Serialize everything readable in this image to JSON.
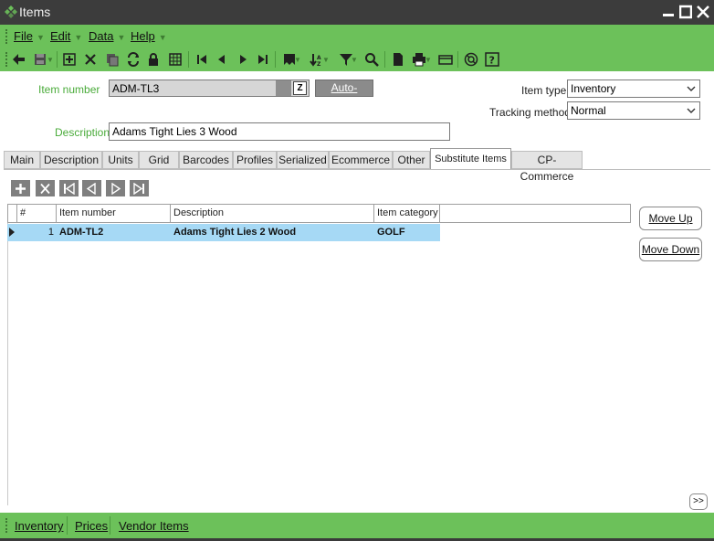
{
  "window": {
    "title": "Items",
    "app_icon": "pinwheel-icon",
    "controls": [
      "minimize-icon",
      "maximize-icon",
      "close-icon"
    ]
  },
  "menu": {
    "items": [
      {
        "label": "File"
      },
      {
        "label": "Edit"
      },
      {
        "label": "Data"
      },
      {
        "label": "Help"
      }
    ]
  },
  "toolbar": {
    "icons": [
      "back-arrow-icon",
      "save-icon",
      "add-icon",
      "delete-icon",
      "copy-icon",
      "refresh-icon",
      "lock-icon",
      "grid-icon",
      "first-record-icon",
      "previous-record-icon",
      "next-record-icon",
      "last-record-icon",
      "bookmark-icon",
      "sort-icon",
      "filter-icon",
      "search-icon",
      "document-icon",
      "print-icon",
      "calculator-icon",
      "support-icon",
      "help-icon"
    ]
  },
  "form": {
    "item_number_label": "Item number",
    "item_number_value": "ADM-TL3",
    "auto_assign_label": "Auto-assign",
    "description_label": "Description",
    "description_value": "Adams Tight Lies 3 Wood",
    "item_type_label": "Item type",
    "item_type_value": "Inventory",
    "tracking_method_label": "Tracking method",
    "tracking_method_value": "Normal"
  },
  "tabs": [
    {
      "label": "Main"
    },
    {
      "label": "Description"
    },
    {
      "label": "Units"
    },
    {
      "label": "Grid"
    },
    {
      "label": "Barcodes"
    },
    {
      "label": "Profiles"
    },
    {
      "label": "Serialized"
    },
    {
      "label": "Ecommerce"
    },
    {
      "label": "Other"
    },
    {
      "label": "Substitute Items"
    },
    {
      "label": "CP-Commerce"
    }
  ],
  "active_tab": "Substitute Items",
  "grid": {
    "headers": [
      "#",
      "Item number",
      "Description",
      "Item category"
    ],
    "rows": [
      {
        "num": "1",
        "item_number": "ADM-TL2",
        "description": "Adams Tight Lies 2 Wood",
        "item_category": "GOLF"
      }
    ]
  },
  "side_buttons": {
    "move_up": "Move Up",
    "move_down": "Move Down",
    "more": ">>"
  },
  "bottom_links": [
    {
      "label": "Inventory"
    },
    {
      "label": "Prices"
    },
    {
      "label": "Vendor Items"
    }
  ],
  "colors": {
    "accent_green": "#6cc15a",
    "label_green": "#4aab3a",
    "selected_row": "#a6d9f5",
    "titlebar": "#3c3c3c"
  }
}
